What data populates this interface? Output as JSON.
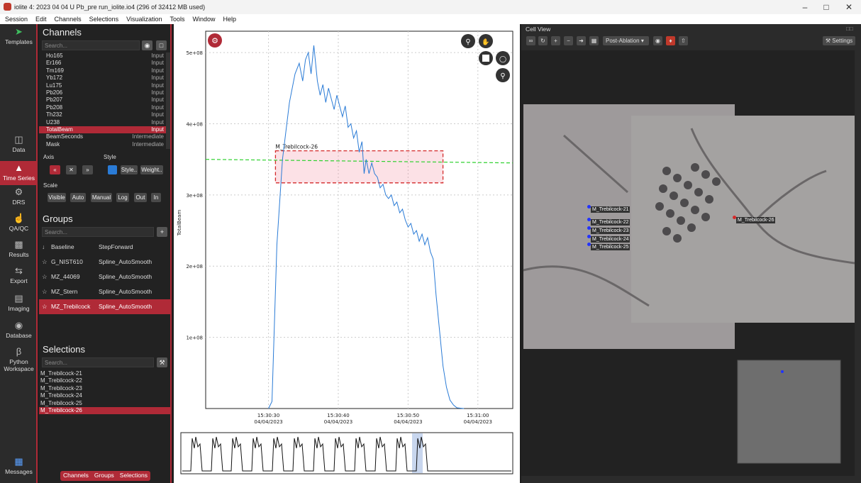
{
  "window": {
    "title": "iolite 4: 2023 04 04 U Pb_pre run_iolite.io4 (296 of 32412 MB used)"
  },
  "menu": [
    "Session",
    "Edit",
    "Channels",
    "Selections",
    "Visualization",
    "Tools",
    "Window",
    "Help"
  ],
  "nav": [
    {
      "label": "Templates",
      "icon": "paper-plane-icon"
    },
    {
      "label": "Data",
      "icon": "database-icon"
    },
    {
      "label": "Time Series",
      "icon": "mountain-chart-icon"
    },
    {
      "label": "DRS",
      "icon": "gear-icon"
    },
    {
      "label": "QA/QC",
      "icon": "thumbs-up-icon"
    },
    {
      "label": "Results",
      "icon": "bar-chart-icon"
    },
    {
      "label": "Export",
      "icon": "swap-arrows-icon"
    },
    {
      "label": "Imaging",
      "icon": "map-icon"
    },
    {
      "label": "Database",
      "icon": "globe-icon"
    },
    {
      "label": "Python Workspace",
      "icon": "python-icon"
    },
    {
      "label": "Messages",
      "icon": "message-icon"
    }
  ],
  "channels": {
    "title": "Channels",
    "search_placeholder": "Search...",
    "items": [
      {
        "name": "Ho165",
        "type": "Input"
      },
      {
        "name": "Er166",
        "type": "Input"
      },
      {
        "name": "Tm169",
        "type": "Input"
      },
      {
        "name": "Yb172",
        "type": "Input"
      },
      {
        "name": "Lu175",
        "type": "Input"
      },
      {
        "name": "Pb206",
        "type": "Input"
      },
      {
        "name": "Pb207",
        "type": "Input"
      },
      {
        "name": "Pb208",
        "type": "Input"
      },
      {
        "name": "Th232",
        "type": "Input"
      },
      {
        "name": "U238",
        "type": "Input"
      },
      {
        "name": "TotalBeam",
        "type": "Input"
      },
      {
        "name": "BeamSeconds",
        "type": "Intermediate"
      },
      {
        "name": "Mask",
        "type": "Intermediate"
      }
    ],
    "selected": "TotalBeam"
  },
  "axis": {
    "label": "Axis",
    "style_label": "Style",
    "style_btn": "Style..",
    "weight_btn": "Weight.."
  },
  "scale": {
    "label": "Scale",
    "buttons": [
      "Visible",
      "Auto",
      "Manual",
      "Log",
      "Out",
      "In"
    ]
  },
  "groups": {
    "title": "Groups",
    "search_placeholder": "Search...",
    "items": [
      {
        "name": "Baseline",
        "method": "StepForward",
        "icon": "arrow-down-icon"
      },
      {
        "name": "G_NIST610",
        "method": "Spline_AutoSmooth",
        "icon": "trophy-icon"
      },
      {
        "name": "MZ_44069",
        "method": "Spline_AutoSmooth",
        "icon": "trophy-icon"
      },
      {
        "name": "MZ_Stern",
        "method": "Spline_AutoSmooth",
        "icon": "trophy-icon"
      },
      {
        "name": "MZ_Trebilcock",
        "method": "Spline_AutoSmooth",
        "icon": "trophy-icon"
      }
    ],
    "selected": "MZ_Trebilcock"
  },
  "selections": {
    "title": "Selections",
    "search_placeholder": "Search...",
    "items": [
      "M_Trebilcock-21",
      "M_Trebilcock-22",
      "M_Trebilcock-23",
      "M_Trebilcock-24",
      "M_Trebilcock-25",
      "M_Trebilcock-26"
    ],
    "selected": "M_Trebilcock-26"
  },
  "bottom_tabs": [
    "Channels",
    "Groups",
    "Selections"
  ],
  "chart_data": {
    "type": "line",
    "ylabel": "TotalBeam",
    "yticks": [
      "1e+08",
      "2e+08",
      "3e+08",
      "4e+08",
      "5e+08"
    ],
    "ylim": [
      0,
      530000000.0
    ],
    "xticks": [
      {
        "t": "15:30:30",
        "d": "04/04/2023"
      },
      {
        "t": "15:30:40",
        "d": "04/04/2023"
      },
      {
        "t": "15:30:50",
        "d": "04/04/2023"
      },
      {
        "t": "15:31:00",
        "d": "04/04/2023"
      }
    ],
    "xlim_seconds": [
      21,
      65
    ],
    "selection_label": "M_Trebilcock-26",
    "selection_range": [
      31,
      55
    ],
    "green_line": [
      350000000.0,
      345000000.0
    ],
    "series": [
      {
        "values": [
          [
            30.0,
            0
          ],
          [
            30.5,
            10000000.0
          ],
          [
            31.2,
            230000000.0
          ],
          [
            32.0,
            350000000.0
          ],
          [
            33.0,
            430000000.0
          ],
          [
            33.8,
            470000000.0
          ],
          [
            34.4,
            485000000.0
          ],
          [
            34.9,
            460000000.0
          ],
          [
            35.3,
            490000000.0
          ],
          [
            35.7,
            500000000.0
          ],
          [
            36.1,
            470000000.0
          ],
          [
            36.5,
            510000000.0
          ],
          [
            37.0,
            460000000.0
          ],
          [
            37.4,
            440000000.0
          ],
          [
            37.8,
            455000000.0
          ],
          [
            38.2,
            430000000.0
          ],
          [
            38.6,
            450000000.0
          ],
          [
            39.0,
            435000000.0
          ],
          [
            39.4,
            420000000.0
          ],
          [
            39.8,
            440000000.0
          ],
          [
            40.2,
            425000000.0
          ],
          [
            40.6,
            410000000.0
          ],
          [
            41.0,
            425000000.0
          ],
          [
            41.4,
            395000000.0
          ],
          [
            41.8,
            400000000.0
          ],
          [
            42.2,
            380000000.0
          ],
          [
            42.6,
            390000000.0
          ],
          [
            43.0,
            360000000.0
          ],
          [
            43.4,
            375000000.0
          ],
          [
            43.7,
            330000000.0
          ],
          [
            44.0,
            350000000.0
          ],
          [
            44.4,
            330000000.0
          ],
          [
            44.8,
            345000000.0
          ],
          [
            45.2,
            330000000.0
          ],
          [
            45.6,
            325000000.0
          ],
          [
            46.0,
            310000000.0
          ],
          [
            46.4,
            315000000.0
          ],
          [
            46.8,
            300000000.0
          ],
          [
            47.2,
            295000000.0
          ],
          [
            47.6,
            300000000.0
          ],
          [
            48.0,
            285000000.0
          ],
          [
            48.4,
            290000000.0
          ],
          [
            48.8,
            275000000.0
          ],
          [
            49.2,
            280000000.0
          ],
          [
            49.6,
            265000000.0
          ],
          [
            50.0,
            255000000.0
          ],
          [
            50.4,
            260000000.0
          ],
          [
            50.8,
            245000000.0
          ],
          [
            51.2,
            250000000.0
          ],
          [
            51.6,
            235000000.0
          ],
          [
            52.0,
            245000000.0
          ],
          [
            52.4,
            230000000.0
          ],
          [
            52.8,
            240000000.0
          ],
          [
            53.2,
            220000000.0
          ],
          [
            53.6,
            210000000.0
          ],
          [
            54.0,
            160000000.0
          ],
          [
            54.5,
            110000000.0
          ],
          [
            55.0,
            60000000.0
          ],
          [
            55.5,
            30000000.0
          ],
          [
            56.0,
            12000000.0
          ],
          [
            56.5,
            5000000.0
          ],
          [
            57.0,
            1000000.0
          ],
          [
            58.0,
            0
          ]
        ]
      }
    ]
  },
  "cell_view": {
    "title": "Cell View",
    "mode": "Post-Ablation",
    "settings": "Settings",
    "labels": [
      "M_Trebilcock-21",
      "M_Trebilcock-22",
      "M_Trebilcock-23",
      "M_Trebilcock-24",
      "M_Trebilcock-25",
      "M_Trebilcock-26"
    ]
  }
}
